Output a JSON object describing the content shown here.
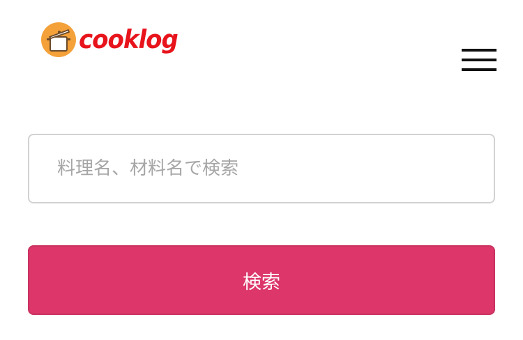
{
  "header": {
    "logo_text": "cooklog",
    "logo_color": "#e8141c",
    "logo_icon": "pot-icon",
    "menu_icon": "hamburger-menu-icon"
  },
  "search": {
    "placeholder": "料理名、材料名で検索",
    "value": "",
    "button_label": "検索",
    "button_color": "#dc366a"
  }
}
